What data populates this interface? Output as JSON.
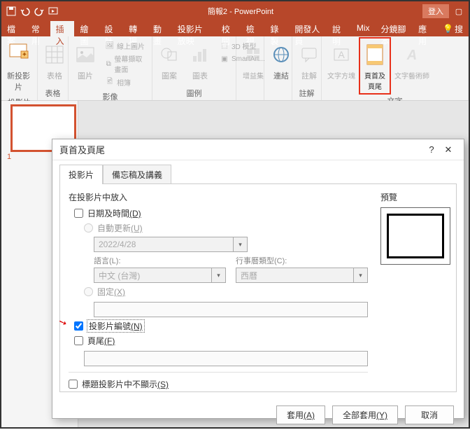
{
  "titlebar": {
    "title": "簡報2 - PowerPoint",
    "signin": "登入"
  },
  "tabs": {
    "file": "檔案",
    "home": "常用",
    "insert": "插入",
    "draw": "繪圖",
    "design": "設計",
    "transitions": "轉場",
    "animations": "動畫",
    "slideshow": "投影片放映",
    "review": "校閱",
    "view": "檢視",
    "recording": "錄製",
    "developer": "開發人員",
    "help": "說明",
    "mix": "Mix",
    "script": "分鏡腳本",
    "apps": "應用",
    "search": "搜"
  },
  "ribbon": {
    "newSlide": "新投影\n片",
    "table": "表格",
    "slidesGroup": "投影片",
    "tablesGroup": "表格",
    "picture": "圖片",
    "screenshot": "螢幕擷取畫面",
    "album": "相簿",
    "onlinePic": "線上圖片",
    "imagesGroup": "影像",
    "shapes": "圖案",
    "chart": "圖表",
    "smartart": "SmartArt...",
    "model3d": "3D 模型",
    "illustGroup": "圖例",
    "addin": "增益集",
    "link": "連結",
    "comment": "註解",
    "commentGroup": "註解",
    "textbox": "文字方塊",
    "headerFooter": "頁首及\n頁尾",
    "wordart": "文字藝術師",
    "textGroup": "文字"
  },
  "thumbnail": {
    "num": "1"
  },
  "dialog": {
    "title": "頁首及頁尾",
    "tabSlide": "投影片",
    "tabNotes": "備忘稿及講義",
    "sectionLabel": "在投影片中放入",
    "dateTime": "日期及時間",
    "dateTimeKey": "(D)",
    "autoUpdate": "自動更新",
    "autoUpdateKey": "(U)",
    "dateValue": "2022/4/28",
    "langLabel": "語言",
    "langKey": "(L)",
    "langValue": "中文 (台灣)",
    "calLabel": "行事曆類型",
    "calKey": "(C)",
    "calValue": "西曆",
    "fixed": "固定",
    "fixedKey": "(X)",
    "slideNum": "投影片編號",
    "slideNumKey": "(N)",
    "footer": "頁尾",
    "footerKey": "(F)",
    "dontShowTitle": "標題投影片中不顯示",
    "dontShowTitleKey": "(S)",
    "preview": "預覽",
    "apply": "套用",
    "applyKey": "(A)",
    "applyAll": "全部套用",
    "applyAllKey": "(Y)",
    "cancel": "取消"
  }
}
